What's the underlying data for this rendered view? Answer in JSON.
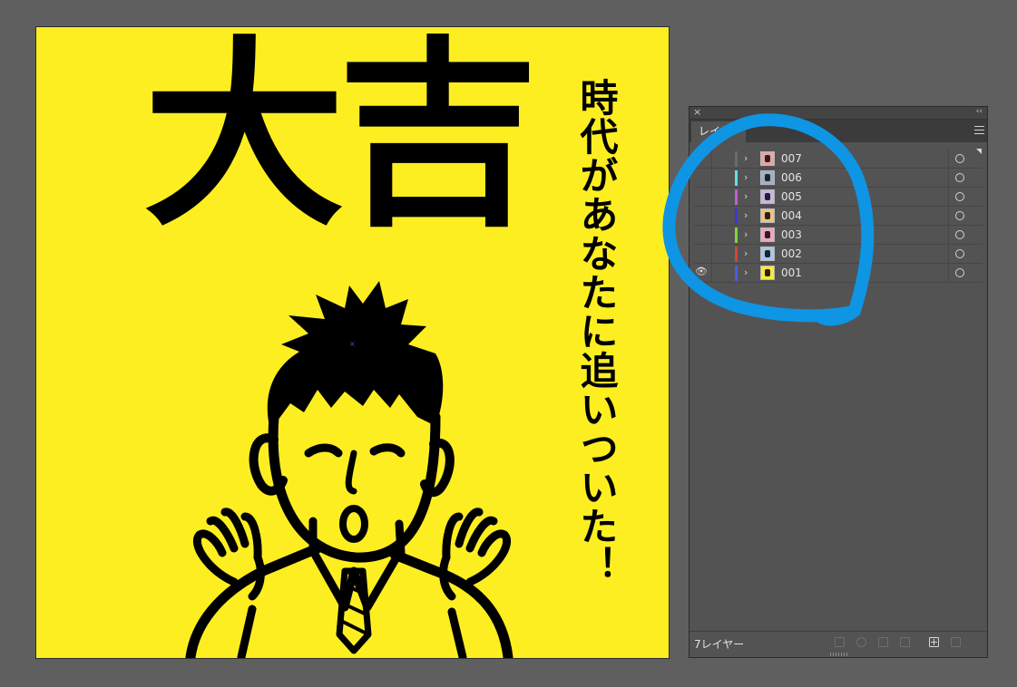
{
  "artboard": {
    "title": "大吉",
    "vertical_text": "時代があなたに追いついた！",
    "background": "#fdee22"
  },
  "layers_panel": {
    "tab_label": "レイヤー",
    "footer_count": "7レイヤー",
    "layers": [
      {
        "name": "007",
        "color": "#6b6b6b",
        "visible": false,
        "thumb": "#e9a3a8"
      },
      {
        "name": "006",
        "color": "#5fe3e0",
        "visible": false,
        "thumb": "#a0b0c8"
      },
      {
        "name": "005",
        "color": "#c45bd6",
        "visible": false,
        "thumb": "#c8b6e0"
      },
      {
        "name": "004",
        "color": "#3838d6",
        "visible": false,
        "thumb": "#f1c27a"
      },
      {
        "name": "003",
        "color": "#7fd43c",
        "visible": false,
        "thumb": "#eea6c2"
      },
      {
        "name": "002",
        "color": "#d0473a",
        "visible": false,
        "thumb": "#a9c6ec"
      },
      {
        "name": "001",
        "color": "#4a5ce0",
        "visible": true,
        "thumb": "#fde938"
      }
    ]
  },
  "annotation": {
    "circle_color": "#0e95e4"
  },
  "icons": [
    "close-icon",
    "collapse-icon",
    "panel-menu-icon",
    "eye-icon",
    "expand-chevron-icon",
    "target-circle-icon",
    "export-icon",
    "search-icon",
    "clipping-mask-icon",
    "sublayer-icon",
    "new-layer-icon",
    "trash-icon"
  ]
}
